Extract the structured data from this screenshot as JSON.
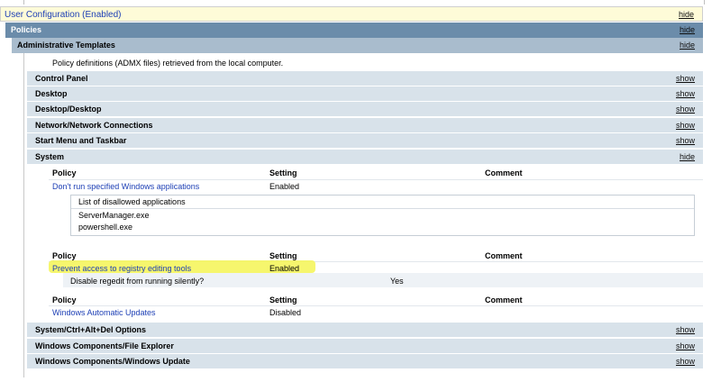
{
  "top_section": {
    "title": "User Configuration (Enabled)",
    "toggle": "hide"
  },
  "policies": {
    "title": "Policies",
    "toggle": "hide"
  },
  "admin_templates": {
    "title": "Administrative Templates",
    "toggle": "hide",
    "description": "Policy definitions (ADMX files) retrieved from the local computer."
  },
  "categories_before": [
    {
      "title": "Control Panel",
      "toggle": "show"
    },
    {
      "title": "Desktop",
      "toggle": "show"
    },
    {
      "title": "Desktop/Desktop",
      "toggle": "show"
    },
    {
      "title": "Network/Network Connections",
      "toggle": "show"
    },
    {
      "title": "Start Menu and Taskbar",
      "toggle": "show"
    }
  ],
  "system": {
    "title": "System",
    "toggle": "hide",
    "columns": {
      "policy": "Policy",
      "setting": "Setting",
      "comment": "Comment"
    },
    "policy1": {
      "name": "Don't run specified Windows applications",
      "setting": "Enabled",
      "list_header": "List of disallowed applications",
      "list_items": [
        "ServerManager.exe",
        "powershell.exe"
      ]
    },
    "policy2": {
      "name": "Prevent access to registry editing tools",
      "setting": "Enabled",
      "option_label": "Disable regedit from running silently?",
      "option_value": "Yes"
    },
    "policy3": {
      "name": "Windows Automatic Updates",
      "setting": "Disabled"
    }
  },
  "categories_after": [
    {
      "title": "System/Ctrl+Alt+Del Options",
      "toggle": "show"
    },
    {
      "title": "Windows Components/File Explorer",
      "toggle": "show"
    },
    {
      "title": "Windows Components/Windows Update",
      "toggle": "show"
    }
  ],
  "colors": {
    "header_dark": "#6b8caa",
    "header_mid": "#a9bccd",
    "header_light": "#d8e2ea",
    "link": "#1d3fb5",
    "highlight": "#f5f55d"
  }
}
